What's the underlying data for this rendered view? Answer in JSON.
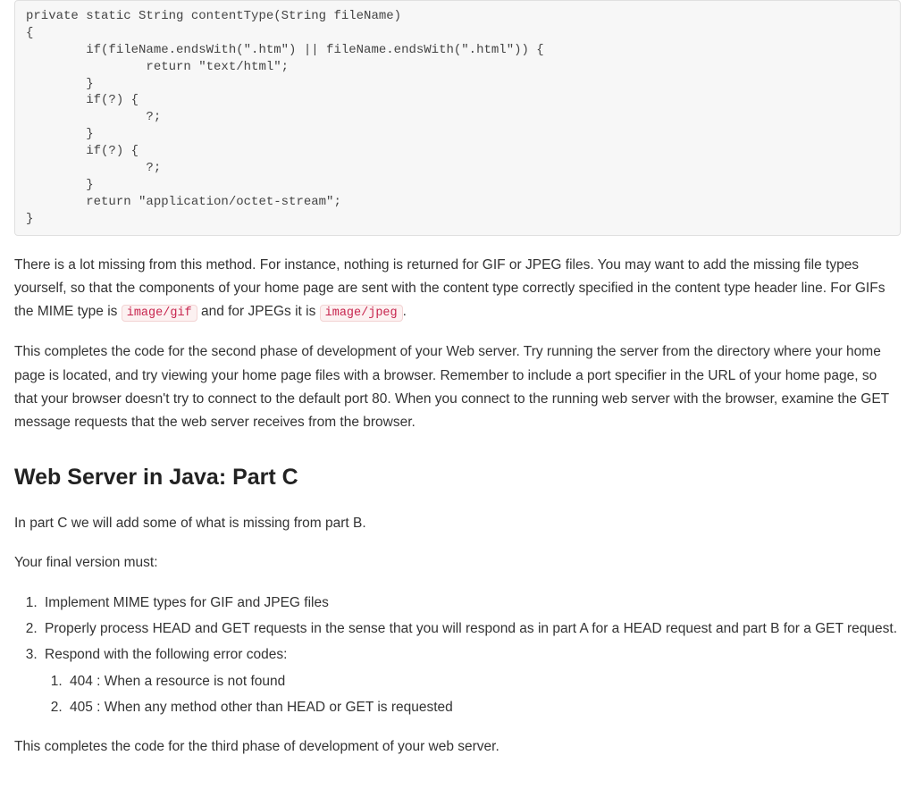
{
  "codeBlock": "private static String contentType(String fileName)\n{\n        if(fileName.endsWith(\".htm\") || fileName.endsWith(\".html\")) {\n                return \"text/html\";\n        }\n        if(?) {\n                ?;\n        }\n        if(?) {\n                ?;\n        }\n        return \"application/octet-stream\";\n}",
  "p1_a": "There is a lot missing from this method. For instance, nothing is returned for GIF or JPEG files. You may want to add the missing file types yourself, so that the components of your home page are sent with the content type correctly specified in the content type header line. For GIFs the MIME type is ",
  "mime1": "image/gif",
  "p1_b": " and for JPEGs it is ",
  "mime2": "image/jpeg",
  "p1_c": ".",
  "p2": "This completes the code for the second phase of development of your Web server. Try running the server from the directory where your home page is located, and try viewing your home page files with a browser. Remember to include a port specifier in the URL of your home page, so that your browser doesn't try to connect to the default port 80. When you connect to the running web server with the browser, examine the GET message requests that the web server receives from the browser.",
  "heading": "Web Server in Java: Part C",
  "p3": "In part C we will add some of what is missing from part B.",
  "p4": "Your final version must:",
  "requirements": [
    "Implement MIME types for GIF and JPEG files",
    "Properly process HEAD and GET requests in the sense that you will respond as in part A for a HEAD request and part B for a GET request.",
    "Respond with the following error codes:"
  ],
  "errorCodes": [
    "404 : When a resource is not found",
    "405 : When any method other than HEAD or GET is requested"
  ],
  "p5": "This completes the code for the third phase of development of your web server."
}
